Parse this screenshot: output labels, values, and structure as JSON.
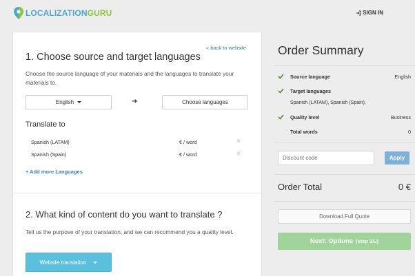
{
  "header": {
    "logo_part1": "LOCALIZATION",
    "logo_part2": "GURU",
    "signin": "SIGN IN"
  },
  "colors": {
    "brand_blue": "#4aa9c8",
    "brand_green": "#8cc63f",
    "check_green": "#5a8a3c",
    "next_button": "#a1d49b",
    "web_button": "#5bc0de",
    "apply_button": "#7fb0d6"
  },
  "step1": {
    "back_link": "« back to website",
    "title": "1. Choose source and target languages",
    "description": "Choose the source language of your materials and the languages to translate your materials to.",
    "source_language": "English",
    "arrow_icon": "arrow-right-icon",
    "target_button": "Choose languages",
    "translate_to_heading": "Translate to",
    "languages": [
      {
        "name": "Spanish (LATAM)",
        "price": "€ / word",
        "remove": "×"
      },
      {
        "name": "Spanish (Spain)",
        "price": "€ / word",
        "remove": "×"
      }
    ],
    "add_more": "+ Add more Languages"
  },
  "step2": {
    "title": "2. What kind of content do you want to translate ?",
    "description": "Tell us the purpose of your translation, and we can recommend you a quality level.",
    "content_type": "Website translation"
  },
  "summary": {
    "title": "Order Summary",
    "rows": [
      {
        "label": "Source language",
        "value": "English"
      },
      {
        "label": "Target languages",
        "value": ""
      },
      {
        "label": "Quality level",
        "value": "Business"
      },
      {
        "label": "Total words",
        "value": "0"
      }
    ],
    "target_list": "Spanish (LATAM), Spanish (Spain),",
    "discount_placeholder": "Discount code",
    "apply": "Apply",
    "order_total_label": "Order Total",
    "order_total_value": "0 €",
    "download": "Download Full Quote",
    "next": "Next: Options",
    "next_step": "(step 2/3)"
  }
}
